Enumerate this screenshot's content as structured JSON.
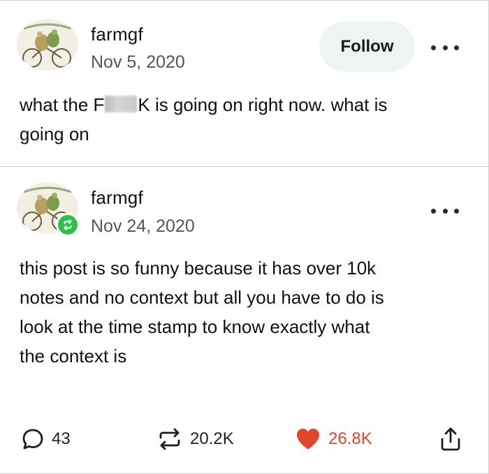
{
  "posts": [
    {
      "username": "farmgf",
      "date": "Nov 5, 2020",
      "follow_label": "Follow",
      "text_before": "what the F",
      "text_after": "K is going on right now. what is",
      "text_line2": "going on"
    },
    {
      "username": "farmgf",
      "date": "Nov 24, 2020",
      "text_lines": [
        "this post is so funny because it has over 10k",
        "notes and no context but all you have to do is",
        "look at the time stamp to know exactly what",
        "the context is"
      ]
    }
  ],
  "actions": {
    "replies": "43",
    "reblogs": "20.2K",
    "likes": "26.8K"
  },
  "colors": {
    "like_red": "#e0462e",
    "reblog_green": "#2fbf4b",
    "follow_bg": "#eef3f4"
  },
  "icons": {
    "avatar": "frog-and-toad-bicycle-avatar",
    "reblog_badge": "reblog-icon",
    "more": "ellipsis-icon",
    "reply": "speech-bubble-icon",
    "reblog": "reblog-arrows-icon",
    "like": "heart-icon",
    "share": "share-icon"
  }
}
